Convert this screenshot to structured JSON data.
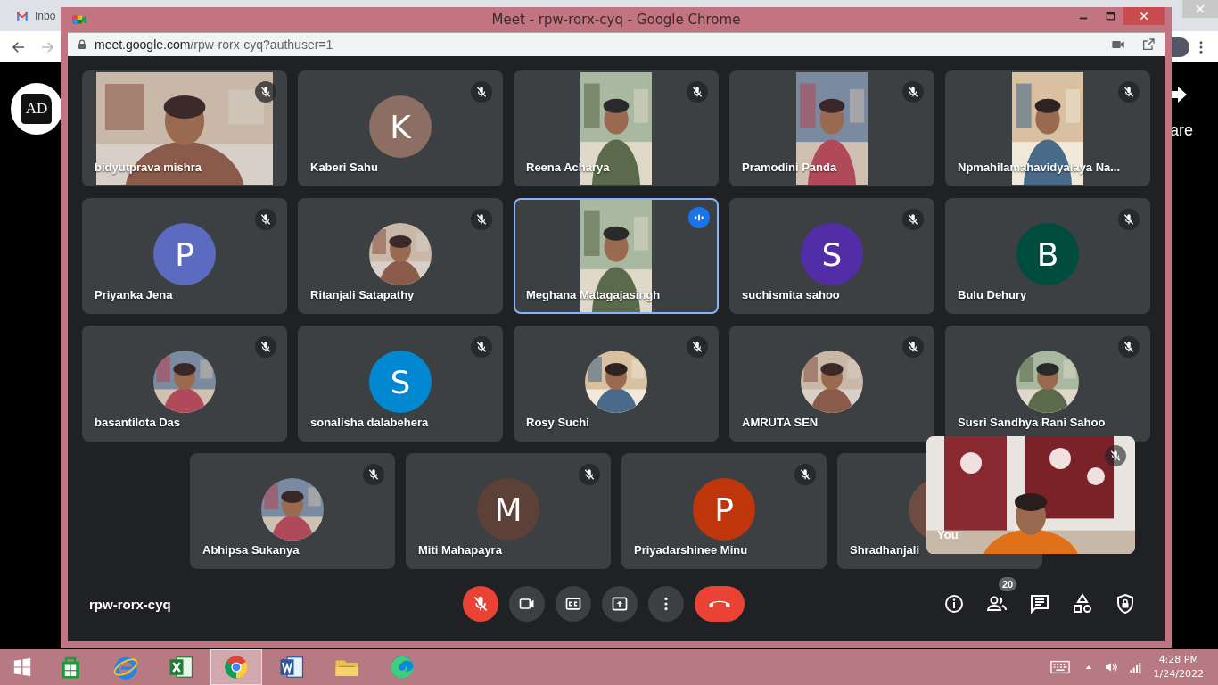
{
  "background_browser": {
    "tab_title": "Inbo",
    "logo_text": "AD",
    "page_text": "are"
  },
  "window": {
    "title": "Meet - rpw-rorx-cyq - Google Chrome",
    "url_host": "meet.google.com",
    "url_path": "/rpw-rorx-cyq?authuser=1"
  },
  "tiles": [
    {
      "name": "bidyutprava mishra",
      "kind": "camera",
      "muted": true,
      "speaking": false
    },
    {
      "name": "Kaberi Sahu",
      "kind": "letter",
      "letter": "K",
      "color": "#8d6e63",
      "muted": true,
      "speaking": false
    },
    {
      "name": "Reena Acharya",
      "kind": "portrait",
      "muted": true,
      "speaking": false
    },
    {
      "name": "Pramodini Panda",
      "kind": "portrait",
      "muted": true,
      "speaking": false
    },
    {
      "name": "Npmahilamahavidyalaya Na...",
      "kind": "portrait",
      "muted": true,
      "speaking": false
    },
    {
      "name": "Priyanka Jena",
      "kind": "letter",
      "letter": "P",
      "color": "#5c6bc0",
      "muted": true,
      "speaking": false
    },
    {
      "name": "Ritanjali Satapathy",
      "muted": true,
      "speaking": false
    },
    {
      "name": "Meghana Matagajasingh",
      "kind": "portrait",
      "muted": false,
      "speaking": true
    },
    {
      "name": "suchismita sahoo",
      "kind": "letter",
      "letter": "S",
      "color": "#512da8",
      "muted": true,
      "speaking": false
    },
    {
      "name": "Bulu Dehury",
      "kind": "letter",
      "letter": "B",
      "color": "#004d40",
      "muted": true,
      "speaking": false
    },
    {
      "name": "basantilota Das",
      "muted": true,
      "speaking": false
    },
    {
      "name": "sonalisha dalabehera",
      "kind": "letter",
      "letter": "S",
      "color": "#0288d1",
      "muted": true,
      "speaking": false
    },
    {
      "name": "Rosy Suchi",
      "muted": true,
      "speaking": false
    },
    {
      "name": "AMRUTA SEN",
      "muted": true,
      "speaking": false
    },
    {
      "name": "Susri Sandhya Rani Sahoo",
      "muted": true,
      "speaking": false
    },
    {
      "name": "Abhipsa Sukanya",
      "muted": true,
      "speaking": false
    },
    {
      "name": "Miti Mahapayra",
      "kind": "letter",
      "letter": "M",
      "color": "#5d4037",
      "muted": true,
      "speaking": false
    },
    {
      "name": "Priyadarshinee Minu",
      "kind": "letter",
      "letter": "P",
      "color": "#bf360c",
      "muted": true,
      "speaking": false
    },
    {
      "name": "Shradhanjali",
      "kind": "letter",
      "color": "#6d4c41",
      "speaking": false
    }
  ],
  "self_view": {
    "label": "You",
    "muted": true
  },
  "meeting_code": "rpw-rorx-cyq",
  "controls": [
    {
      "kind": "mic",
      "muted": true
    },
    {
      "kind": "camera"
    },
    {
      "kind": "captions"
    },
    {
      "kind": "present"
    },
    {
      "kind": "more"
    },
    {
      "kind": "hangup"
    }
  ],
  "side_controls": [
    {
      "kind": "info"
    },
    {
      "kind": "people",
      "badge": "20"
    },
    {
      "kind": "chat"
    },
    {
      "kind": "activities"
    },
    {
      "kind": "safety"
    }
  ],
  "taskbar": {
    "apps": [
      {
        "kind": "store",
        "selected": false
      },
      {
        "kind": "ie",
        "selected": false
      },
      {
        "kind": "excel",
        "selected": false
      },
      {
        "kind": "chrome",
        "selected": true
      },
      {
        "kind": "word",
        "selected": false
      },
      {
        "kind": "explorer",
        "selected": false
      },
      {
        "kind": "edge",
        "selected": false
      }
    ],
    "time": "4:28 PM",
    "date": "1/24/2022"
  }
}
